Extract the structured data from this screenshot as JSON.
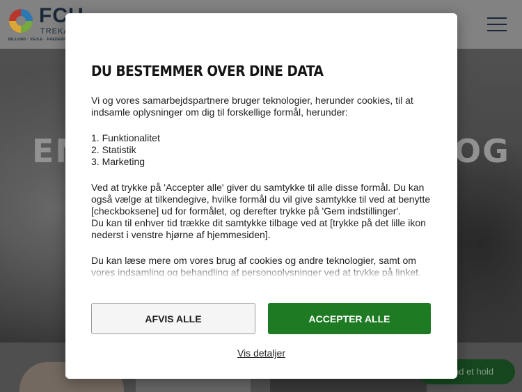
{
  "site": {
    "logo": {
      "word": "FCU",
      "sub": "TREKA",
      "tagline": "BILLUND · VEJLE · FREDERICIA"
    },
    "hero": {
      "text_left": "EN",
      "text_right": "OG"
    },
    "floating_button_label": "nd et hold"
  },
  "consent": {
    "title": "DU BESTEMMER OVER DINE DATA",
    "intro": "Vi og vores samarbejdspartnere bruger teknologier, herunder cookies, til at indsamle oplysninger om dig til forskellige formål, herunder:",
    "purposes": [
      "1. Funktionalitet",
      "2. Statistik",
      "3. Marketing"
    ],
    "paragraph2a": "Ved at trykke på 'Accepter alle' giver du samtykke til alle disse formål. Du kan også vælge at tilkendegive, hvilke formål du vil give samtykke til ved at benytte [checkboksene] ud for formålet, og derefter trykke på 'Gem indstillinger'.",
    "paragraph2b": "Du kan til enhver tid trække dit samtykke tilbage ved at [trykke på det lille ikon nederst i venstre hjørne af hjemmesiden].",
    "paragraph3": "Du kan læse mere om vores brug af cookies og andre teknologier, samt om vores indsamling og behandling af personoplysninger ved at trykke på linket.",
    "reject_label": "AFVIS ALLE",
    "accept_label": "ACCEPTER ALLE",
    "details_label": "Vis detaljer",
    "accent_color": "#1e7a23"
  }
}
